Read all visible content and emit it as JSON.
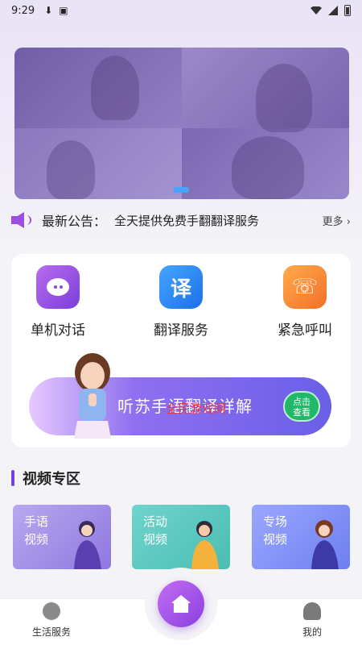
{
  "status_bar": {
    "time": "9:29",
    "icons": [
      "download-icon",
      "gallery-icon",
      "wifi-icon",
      "signal-icon",
      "battery-icon"
    ]
  },
  "notice": {
    "label": "最新公告：",
    "text": "全天提供免费手翻翻译服务",
    "more": "更多"
  },
  "services": [
    {
      "label": "单机对话",
      "icon": "chat-bubble-icon"
    },
    {
      "label": "翻译服务",
      "icon": "translate-icon",
      "glyph": "译"
    },
    {
      "label": "紧急呼叫",
      "icon": "sos-phone-icon"
    }
  ],
  "promo": {
    "title": "听苏手语翻译详解",
    "watermark": "全民游戏网",
    "button": "点击\n查看"
  },
  "video_section": {
    "title": "视频专区",
    "items": [
      {
        "label": "手语\n视频"
      },
      {
        "label": "活动\n视频"
      },
      {
        "label": "专场\n视频"
      }
    ]
  },
  "tab_bar": {
    "left": "生活服务",
    "right": "我的"
  },
  "colors": {
    "accent": "#8a3fe0",
    "banner_dot": "#4aa3ff"
  }
}
